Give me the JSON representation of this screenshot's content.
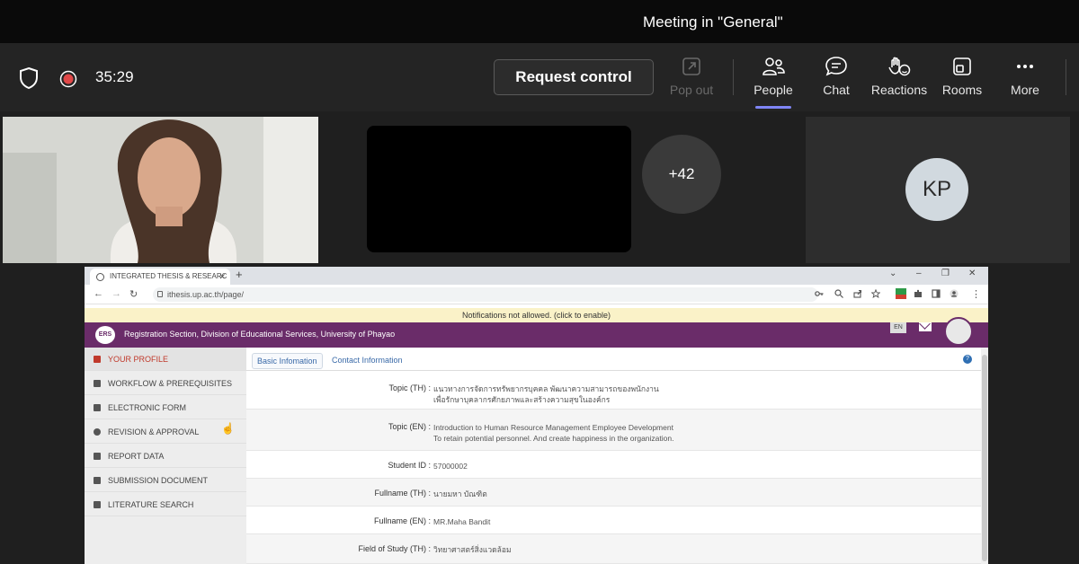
{
  "meeting": {
    "title": "Meeting in \"General\"",
    "timer": "35:29",
    "request_control": "Request control",
    "buttons": [
      {
        "label": "Pop out",
        "icon": "pop-out-icon"
      },
      {
        "label": "People",
        "icon": "people-icon"
      },
      {
        "label": "Chat",
        "icon": "chat-icon"
      },
      {
        "label": "Reactions",
        "icon": "reactions-icon"
      },
      {
        "label": "Rooms",
        "icon": "rooms-icon"
      },
      {
        "label": "More",
        "icon": "more-icon"
      }
    ],
    "overflow_count": "+42",
    "participant_initials": "KP",
    "accent_color": "#7f85f5"
  },
  "browser": {
    "tab_title": "INTEGRATED THESIS & RESEARC",
    "url": "ithesis.up.ac.th/page/",
    "notification": "Notifications not allowed. (click to enable)"
  },
  "site": {
    "logo_text": "ERS",
    "header_title": "Registration Section, Division of Educational Services, University of Phayao",
    "lang": "EN",
    "header_color": "#6a2c69",
    "sidebar": [
      {
        "label": "YOUR PROFILE",
        "active": true
      },
      {
        "label": "WORKFLOW & PREREQUISITES"
      },
      {
        "label": "ELECTRONIC FORM"
      },
      {
        "label": "REVISION & APPROVAL"
      },
      {
        "label": "REPORT DATA"
      },
      {
        "label": "SUBMISSION DOCUMENT"
      },
      {
        "label": "LITERATURE SEARCH"
      }
    ],
    "tabs": [
      "Basic Infomation",
      "Contact Information"
    ],
    "fields": [
      {
        "label": "Topic (TH) :",
        "value": "แนวทางการจัดการทรัพยากรบุคคล พัฒนาความสามารถของพนักงาน",
        "value2": "เพื่อรักษาบุคลากรศักยภาพและสร้างความสุขในองค์กร"
      },
      {
        "label": "Topic (EN) :",
        "value": "Introduction to Human Resource Management Employee Development",
        "value2": "To retain potential personnel. And create happiness in the organization."
      },
      {
        "label": "Student ID :",
        "value": "57000002"
      },
      {
        "label": "Fullname (TH) :",
        "value": "นายมหา บัณฑิต"
      },
      {
        "label": "Fullname (EN) :",
        "value": "MR.Maha Bandit"
      },
      {
        "label": "Field of Study (TH) :",
        "value": "วิทยาศาสตร์สิ่งแวดล้อม"
      }
    ]
  }
}
